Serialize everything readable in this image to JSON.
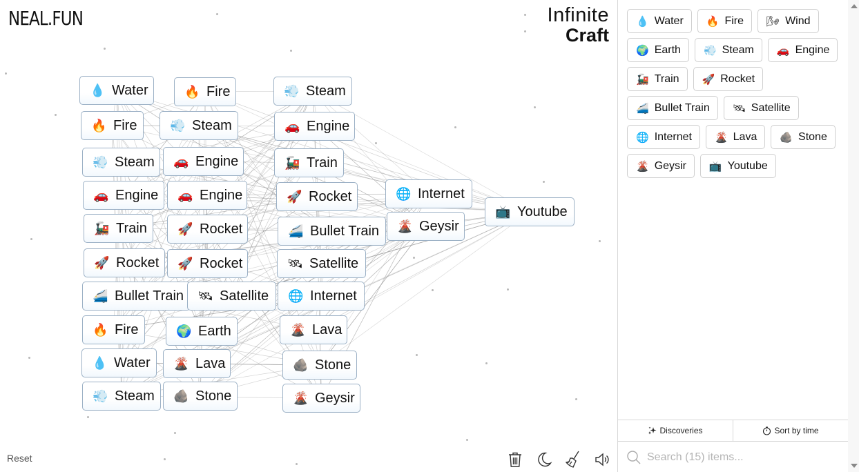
{
  "header": {
    "site_logo": "NEAL.FUN",
    "brand_line1": "Infinite",
    "brand_line2": "Craft"
  },
  "canvas": {
    "nodes": [
      {
        "label": "Water",
        "icon": "💧",
        "icon_name": "water-drop-icon"
      },
      {
        "label": "Fire",
        "icon": "🔥",
        "icon_name": "fire-icon"
      },
      {
        "label": "Steam",
        "icon": "💨",
        "icon_name": "steam-icon"
      },
      {
        "label": "Fire",
        "icon": "🔥",
        "icon_name": "fire-icon"
      },
      {
        "label": "Steam",
        "icon": "💨",
        "icon_name": "steam-icon"
      },
      {
        "label": "Engine",
        "icon": "🚗",
        "icon_name": "car-icon"
      },
      {
        "label": "Steam",
        "icon": "💨",
        "icon_name": "steam-icon"
      },
      {
        "label": "Engine",
        "icon": "🚗",
        "icon_name": "car-icon"
      },
      {
        "label": "Train",
        "icon": "🚂",
        "icon_name": "locomotive-icon"
      },
      {
        "label": "Engine",
        "icon": "🚗",
        "icon_name": "car-icon"
      },
      {
        "label": "Engine",
        "icon": "🚗",
        "icon_name": "car-icon"
      },
      {
        "label": "Rocket",
        "icon": "🚀",
        "icon_name": "rocket-icon"
      },
      {
        "label": "Internet",
        "icon": "🌐",
        "icon_name": "globe-icon"
      },
      {
        "label": "Youtube",
        "icon": "📺",
        "icon_name": "tv-icon"
      },
      {
        "label": "Train",
        "icon": "🚂",
        "icon_name": "locomotive-icon"
      },
      {
        "label": "Rocket",
        "icon": "🚀",
        "icon_name": "rocket-icon"
      },
      {
        "label": "Bullet Train",
        "icon": "🚄",
        "icon_name": "bullet-train-icon"
      },
      {
        "label": "Geysir",
        "icon": "🌋",
        "icon_name": "volcano-icon"
      },
      {
        "label": "Rocket",
        "icon": "🚀",
        "icon_name": "rocket-icon"
      },
      {
        "label": "Rocket",
        "icon": "🚀",
        "icon_name": "rocket-icon"
      },
      {
        "label": "Satellite",
        "icon": "🛰",
        "icon_name": "satellite-icon"
      },
      {
        "label": "Bullet Train",
        "icon": "🚄",
        "icon_name": "bullet-train-icon"
      },
      {
        "label": "Satellite",
        "icon": "🛰",
        "icon_name": "satellite-icon"
      },
      {
        "label": "Internet",
        "icon": "🌐",
        "icon_name": "globe-icon"
      },
      {
        "label": "Fire",
        "icon": "🔥",
        "icon_name": "fire-icon"
      },
      {
        "label": "Earth",
        "icon": "🌍",
        "icon_name": "earth-icon"
      },
      {
        "label": "Lava",
        "icon": "🌋",
        "icon_name": "volcano-icon"
      },
      {
        "label": "Water",
        "icon": "💧",
        "icon_name": "water-drop-icon"
      },
      {
        "label": "Lava",
        "icon": "🌋",
        "icon_name": "volcano-icon"
      },
      {
        "label": "Stone",
        "icon": "🪨",
        "icon_name": "rock-icon"
      },
      {
        "label": "Steam",
        "icon": "💨",
        "icon_name": "steam-icon"
      },
      {
        "label": "Stone",
        "icon": "🪨",
        "icon_name": "rock-icon"
      },
      {
        "label": "Geysir",
        "icon": "🌋",
        "icon_name": "volcano-icon"
      }
    ],
    "reset_label": "Reset"
  },
  "toolbar": {
    "delete_title": "Clear",
    "theme_title": "Dark mode",
    "clean_title": "Clean up",
    "sound_title": "Sound"
  },
  "sidebar": {
    "items": [
      {
        "label": "Water",
        "icon": "💧",
        "icon_name": "water-drop-icon"
      },
      {
        "label": "Fire",
        "icon": "🔥",
        "icon_name": "fire-icon"
      },
      {
        "label": "Wind",
        "icon": "🌬",
        "icon_name": "wind-icon"
      },
      {
        "label": "Earth",
        "icon": "🌍",
        "icon_name": "earth-icon"
      },
      {
        "label": "Steam",
        "icon": "💨",
        "icon_name": "steam-icon"
      },
      {
        "label": "Engine",
        "icon": "🚗",
        "icon_name": "car-icon"
      },
      {
        "label": "Train",
        "icon": "🚂",
        "icon_name": "locomotive-icon"
      },
      {
        "label": "Rocket",
        "icon": "🚀",
        "icon_name": "rocket-icon"
      },
      {
        "label": "Bullet Train",
        "icon": "🚄",
        "icon_name": "bullet-train-icon"
      },
      {
        "label": "Satellite",
        "icon": "🛰",
        "icon_name": "satellite-icon"
      },
      {
        "label": "Internet",
        "icon": "🌐",
        "icon_name": "globe-icon"
      },
      {
        "label": "Lava",
        "icon": "🌋",
        "icon_name": "volcano-icon"
      },
      {
        "label": "Stone",
        "icon": "🪨",
        "icon_name": "rock-icon"
      },
      {
        "label": "Geysir",
        "icon": "🌋",
        "icon_name": "volcano-icon"
      },
      {
        "label": "Youtube",
        "icon": "📺",
        "icon_name": "tv-icon"
      }
    ],
    "discoveries_label": "Discoveries",
    "sort_label": "Sort by time",
    "search_placeholder": "Search (15) items..."
  }
}
